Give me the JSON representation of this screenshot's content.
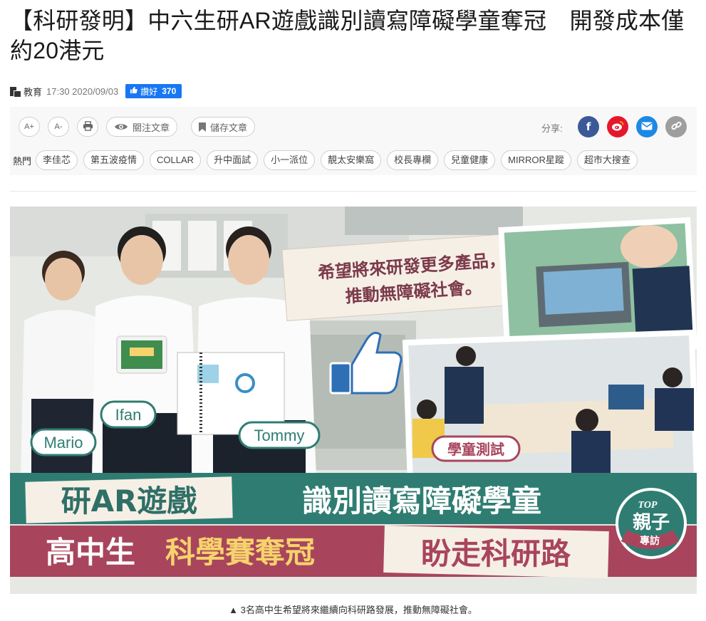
{
  "article": {
    "title": "【科研發明】中六生研AR遊戲識別讀寫障礙學童奪冠　開發成本僅約20港元",
    "category": "教育",
    "time": "17:30 2020/09/03",
    "like_label": "讚好",
    "like_count": "370"
  },
  "toolbar": {
    "font_up": "A+",
    "font_down": "A-",
    "follow_label": "關注文章",
    "save_label": "儲存文章",
    "share_label": "分享:"
  },
  "hot": {
    "label": "熱門",
    "tags": [
      "李佳芯",
      "第五波疫情",
      "COLLAR",
      "升中面試",
      "小一派位",
      "靚太安樂窩",
      "校長專欄",
      "兒童健康",
      "MIRROR星蹤",
      "超市大搜查"
    ]
  },
  "hero": {
    "quote_line1": "希望將來研發更多產品，",
    "quote_line2": "推動無障礙社會。",
    "name_mario": "Mario",
    "name_ifan": "Ifan",
    "name_tommy": "Tommy",
    "test_label": "學童測試",
    "banner1_left": "研AR遊戲",
    "banner1_right": "識別讀寫障礙學童",
    "banner2_a": "高中生",
    "banner2_b": "科學賽奪冠",
    "banner2_c": "盼走科研路",
    "badge_top": "TOP",
    "badge_mid": "親子",
    "badge_bottom": "專訪"
  },
  "caption": "▲ 3名高中生希望將來繼續向科研路發展，推動無障礙社會。",
  "colors": {
    "facebook": "#3b5998",
    "weibo": "#e6162d",
    "email": "#1e88e5",
    "link": "#9e9e9e",
    "banner_green": "#2f7d72",
    "banner_red": "#a8455d"
  }
}
